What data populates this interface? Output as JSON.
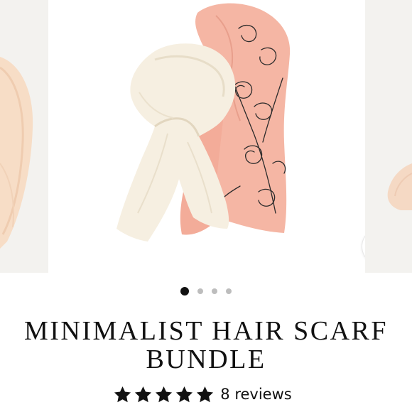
{
  "product": {
    "title": "MINIMALIST HAIR SCARF BUNDLE",
    "rating": 5,
    "rating_max": 5,
    "reviews_label": "8 reviews"
  },
  "gallery": {
    "slide_count": 4,
    "active_slide": 1,
    "zoom_icon": "magnifier-icon",
    "main_image": {
      "subject": "cream-satin-scarf-and-pink-floral-line-art-scarf",
      "colors": {
        "cream": "#f6efe1",
        "pink": "#f3b3a2",
        "line_art": "#2a2a2a"
      }
    }
  },
  "colors": {
    "text": "#111111",
    "star": "#111111",
    "dot_active": "#111111",
    "dot_inactive": "#bdbdbd",
    "background": "#ffffff"
  }
}
